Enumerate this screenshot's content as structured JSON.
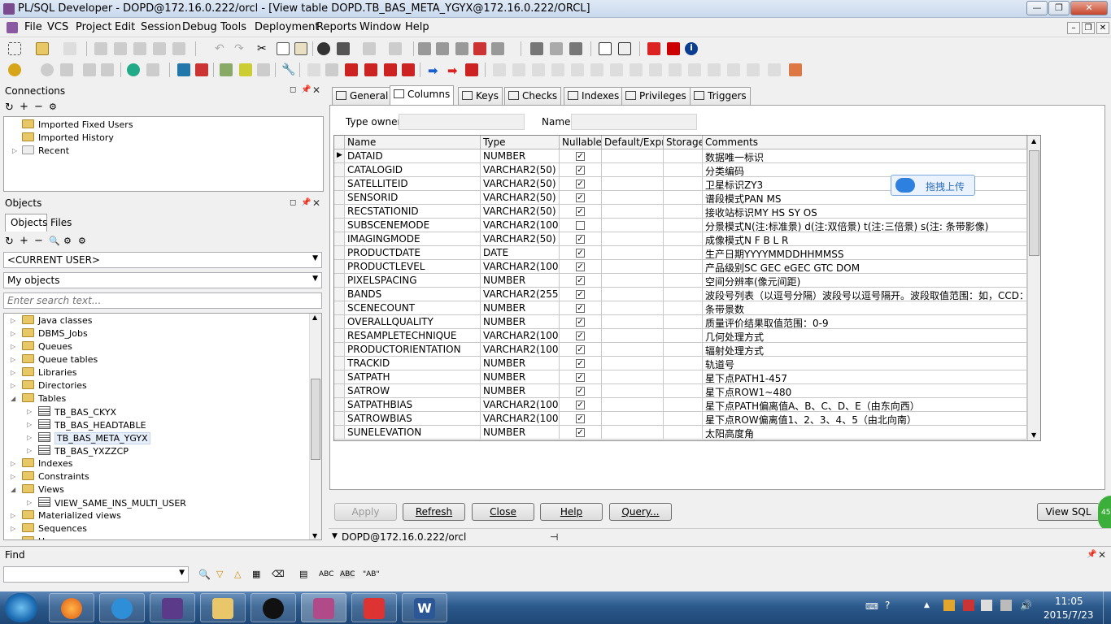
{
  "window": {
    "title": "PL/SQL Developer - DOPD@172.16.0.222/orcl - [View table DOPD.TB_BAS_META_YGYX@172.16.0.222/ORCL]",
    "min": "—",
    "max": "❐",
    "close": "✕"
  },
  "menu": [
    "File",
    "VCS",
    "Project",
    "Edit",
    "Session",
    "Debug",
    "Tools",
    "Deployment",
    "Reports",
    "Window",
    "Help"
  ],
  "connections": {
    "title": "Connections",
    "items": [
      "Imported Fixed Users",
      "Imported History",
      "Recent"
    ]
  },
  "objects": {
    "title": "Objects",
    "tab_objects": "Objects",
    "tab_files": "Files",
    "user_combo": "<CURRENT USER>",
    "filter_combo": "My objects",
    "search_placeholder": "Enter search text...",
    "tree": [
      {
        "label": "Java classes",
        "kind": "folder",
        "level": 0,
        "exp": "▷"
      },
      {
        "label": "DBMS_Jobs",
        "kind": "folder",
        "level": 0,
        "exp": "▷"
      },
      {
        "label": "Queues",
        "kind": "folder",
        "level": 0,
        "exp": "▷"
      },
      {
        "label": "Queue tables",
        "kind": "folder",
        "level": 0,
        "exp": "▷"
      },
      {
        "label": "Libraries",
        "kind": "folder",
        "level": 0,
        "exp": "▷"
      },
      {
        "label": "Directories",
        "kind": "folder",
        "level": 0,
        "exp": "▷"
      },
      {
        "label": "Tables",
        "kind": "folder",
        "level": 0,
        "exp": "◢"
      },
      {
        "label": "TB_BAS_CKYX",
        "kind": "table",
        "level": 1,
        "exp": "▷"
      },
      {
        "label": "TB_BAS_HEADTABLE",
        "kind": "table",
        "level": 1,
        "exp": "▷"
      },
      {
        "label": "TB_BAS_META_YGYX",
        "kind": "table",
        "level": 1,
        "exp": "▷",
        "selected": true
      },
      {
        "label": "TB_BAS_YXZZCP",
        "kind": "table",
        "level": 1,
        "exp": "▷"
      },
      {
        "label": "Indexes",
        "kind": "folder",
        "level": 0,
        "exp": "▷"
      },
      {
        "label": "Constraints",
        "kind": "folder",
        "level": 0,
        "exp": "▷"
      },
      {
        "label": "Views",
        "kind": "folder",
        "level": 0,
        "exp": "◢"
      },
      {
        "label": "VIEW_SAME_INS_MULTI_USER",
        "kind": "table",
        "level": 1,
        "exp": "▷"
      },
      {
        "label": "Materialized views",
        "kind": "folder",
        "level": 0,
        "exp": "▷"
      },
      {
        "label": "Sequences",
        "kind": "folder",
        "level": 0,
        "exp": "▷"
      },
      {
        "label": "Users",
        "kind": "folder",
        "level": 0,
        "exp": "▷"
      }
    ]
  },
  "tabs": [
    "General",
    "Columns",
    "Keys",
    "Checks",
    "Indexes",
    "Privileges",
    "Triggers"
  ],
  "selected_tab": "Columns",
  "fields": {
    "type_owner_label": "Type owner",
    "type_owner_value": "",
    "name_label": "Name",
    "name_value": ""
  },
  "grid": {
    "headers": [
      "Name",
      "Type",
      "Nullable",
      "Default/Expr.",
      "Storage",
      "Comments"
    ],
    "rows": [
      [
        "DATAID",
        "NUMBER",
        true,
        "",
        "",
        "数据唯一标识"
      ],
      [
        "CATALOGID",
        "VARCHAR2(50)",
        true,
        "",
        "",
        "分类编码"
      ],
      [
        "SATELLITEID",
        "VARCHAR2(50)",
        true,
        "",
        "",
        "卫星标识ZY3"
      ],
      [
        "SENSORID",
        "VARCHAR2(50)",
        true,
        "",
        "",
        "谱段模式PAN MS"
      ],
      [
        "RECSTATIONID",
        "VARCHAR2(50)",
        true,
        "",
        "",
        "接收站标识MY HS SY OS"
      ],
      [
        "SUBSCENEMODE",
        "VARCHAR2(100)",
        false,
        "",
        "",
        "分景模式N(注:标准景) d(注:双倍景) t(注:三倍景) s(注: 条带影像)"
      ],
      [
        "IMAGINGMODE",
        "VARCHAR2(50)",
        true,
        "",
        "",
        "成像模式N F B L R"
      ],
      [
        "PRODUCTDATE",
        "DATE",
        true,
        "",
        "",
        "生产日期YYYYMMDDHHMMSS"
      ],
      [
        "PRODUCTLEVEL",
        "VARCHAR2(100)",
        true,
        "",
        "",
        "产品级别SC GEC eGEC GTC DOM"
      ],
      [
        "PIXELSPACING",
        "NUMBER",
        true,
        "",
        "",
        "空间分辨率(像元间距)"
      ],
      [
        "BANDS",
        "VARCHAR2(255)",
        true,
        "",
        "",
        "波段号列表（以逗号分隔）波段号以逗号隔开。波段取值范围：如，CCD："
      ],
      [
        "SCENECOUNT",
        "NUMBER",
        true,
        "",
        "",
        "条带景数"
      ],
      [
        "OVERALLQUALITY",
        "NUMBER",
        true,
        "",
        "",
        "质量评价结果取值范围：0-9"
      ],
      [
        "RESAMPLETECHNIQUE",
        "VARCHAR2(100)",
        true,
        "",
        "",
        "几何处理方式"
      ],
      [
        "PRODUCTORIENTATION",
        "VARCHAR2(100)",
        true,
        "",
        "",
        "辐射处理方式"
      ],
      [
        "TRACKID",
        "NUMBER",
        true,
        "",
        "",
        "轨道号"
      ],
      [
        "SATPATH",
        "NUMBER",
        true,
        "",
        "",
        "星下点PATH1-457"
      ],
      [
        "SATROW",
        "NUMBER",
        true,
        "",
        "",
        "星下点ROW1~480"
      ],
      [
        "SATPATHBIAS",
        "VARCHAR2(100)",
        true,
        "",
        "",
        "星下点PATH偏离值A、B、C、D、E（由东向西）"
      ],
      [
        "SATROWBIAS",
        "VARCHAR2(100)",
        true,
        "",
        "",
        "星下点ROW偏离值1、2、3、4、5（由北向南）"
      ],
      [
        "SUNELEVATION",
        "NUMBER",
        true,
        "",
        "",
        "太阳高度角"
      ]
    ]
  },
  "upload_badge": "拖拽上传",
  "buttons": {
    "apply": "Apply",
    "refresh": "Refresh",
    "close": "Close",
    "help": "Help",
    "query": "Query...",
    "view_sql": "View SQL"
  },
  "status": {
    "connection": "DOPD@172.16.0.222/orcl"
  },
  "find": {
    "title": "Find",
    "value": ""
  },
  "clock": {
    "time": "11:05",
    "date": "2015/7/23"
  },
  "green_badge": "45"
}
